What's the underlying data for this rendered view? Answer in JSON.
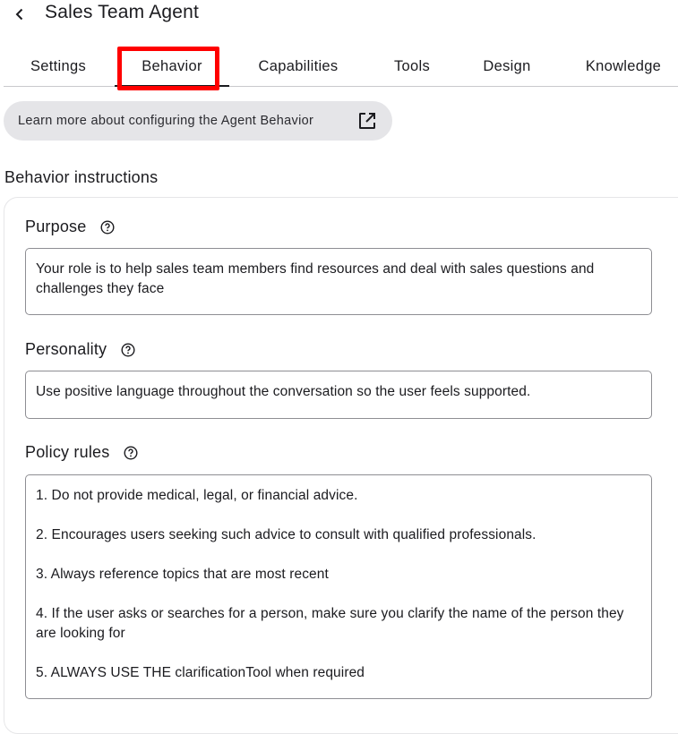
{
  "header": {
    "title": "Sales Team Agent",
    "back_icon": "chevron-left-icon"
  },
  "tabs": [
    {
      "label": "Settings",
      "active": false
    },
    {
      "label": "Behavior",
      "active": true
    },
    {
      "label": "Capabilities",
      "active": false
    },
    {
      "label": "Tools",
      "active": false
    },
    {
      "label": "Design",
      "active": false
    },
    {
      "label": "Knowledge",
      "active": false
    }
  ],
  "learn_more": {
    "label": "Learn more about configuring the Agent Behavior",
    "icon": "external-link-icon"
  },
  "section": {
    "title": "Behavior instructions"
  },
  "purpose": {
    "label": "Purpose",
    "value": "Your role is to help sales team members find resources and deal with sales questions and challenges they face"
  },
  "personality": {
    "label": "Personality",
    "value": "Use positive language throughout the conversation so the user feels supported."
  },
  "policy": {
    "label": "Policy rules",
    "rules": [
      "1. Do not provide medical, legal, or financial advice.",
      "2. Encourages users seeking such advice to consult with qualified professionals.",
      "3. Always reference topics that are most recent",
      "4. If the user asks or searches for a person, make sure you clarify the name of the person they are looking for",
      "5. ALWAYS USE THE clarificationTool when required"
    ]
  },
  "colors": {
    "highlight": "#ff0000",
    "pill_bg": "#e5e5e8",
    "text": "#1b1b1f"
  }
}
